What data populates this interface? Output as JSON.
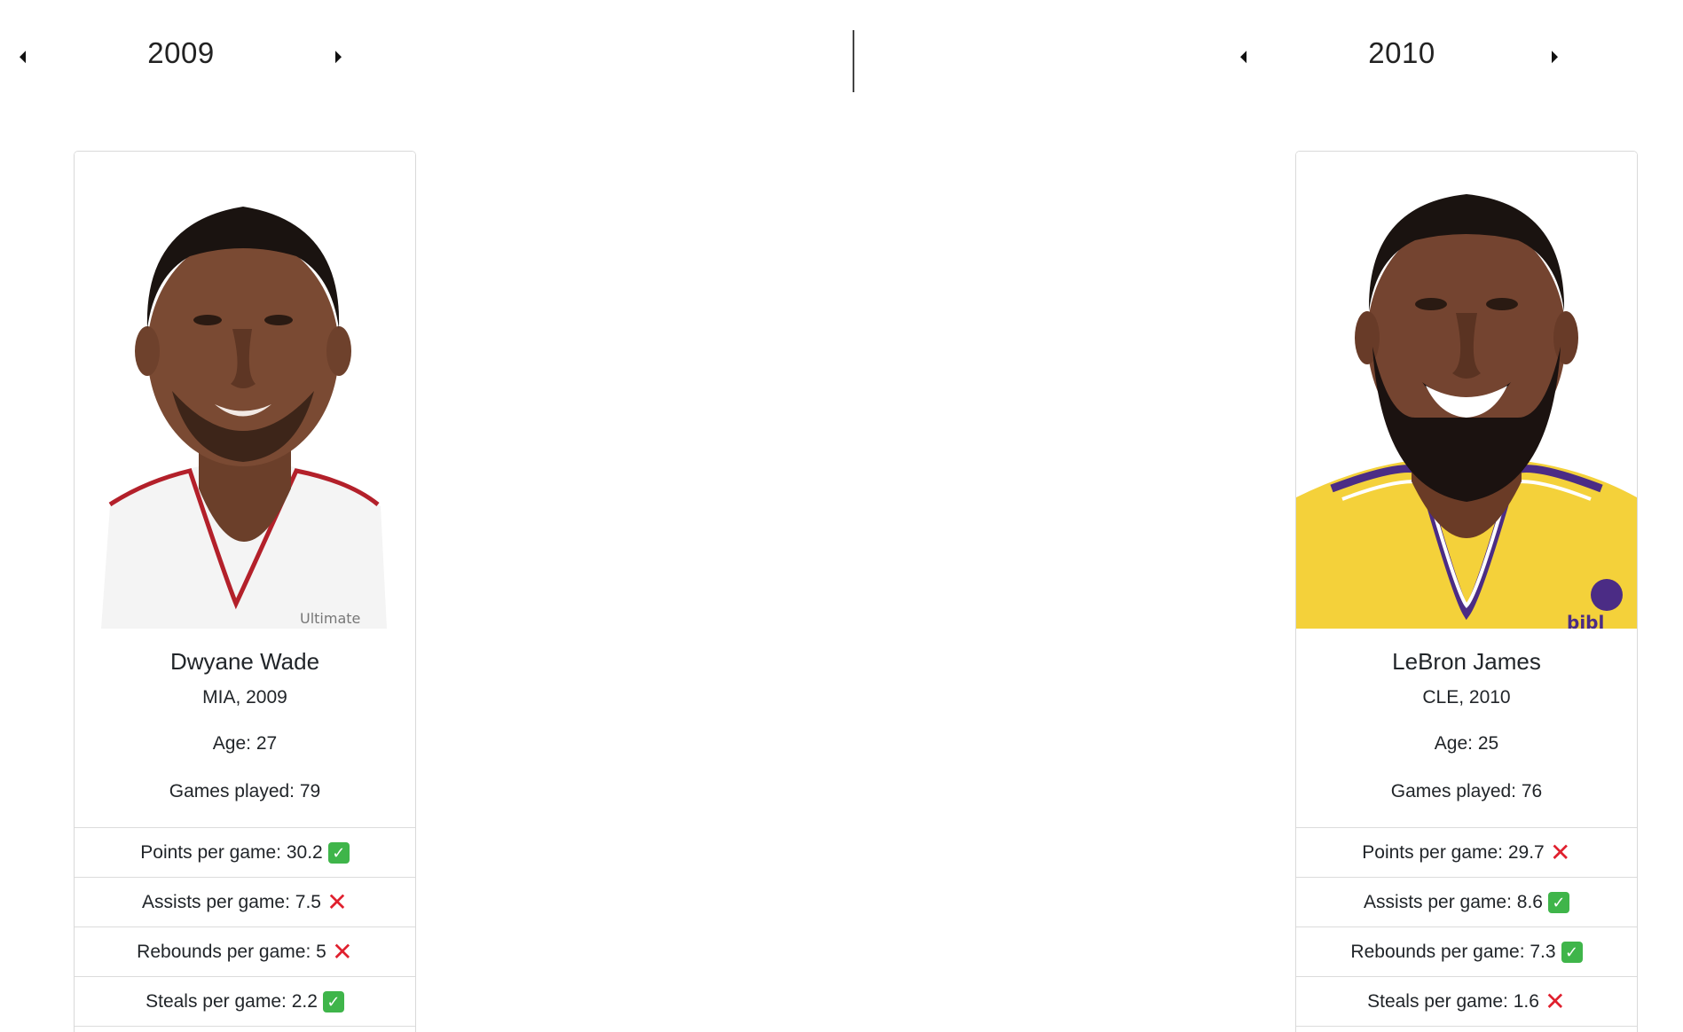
{
  "left": {
    "year": "2009",
    "player": {
      "name": "Dwyane Wade",
      "team_year": "MIA, 2009",
      "age": "Age: 27",
      "games": "Games played: 79",
      "stats": [
        {
          "label": "Points per game: 30.2",
          "result": "check"
        },
        {
          "label": "Assists per game: 7.5",
          "result": "cross"
        },
        {
          "label": "Rebounds per game: 5",
          "result": "cross"
        },
        {
          "label": "Steals per game: 2.2",
          "result": "check"
        }
      ],
      "photo_jersey_text": "Ultimate"
    }
  },
  "right": {
    "year": "2010",
    "player": {
      "name": "LeBron James",
      "team_year": "CLE, 2010",
      "age": "Age: 25",
      "games": "Games played: 76",
      "stats": [
        {
          "label": "Points per game: 29.7",
          "result": "cross"
        },
        {
          "label": "Assists per game: 8.6",
          "result": "check"
        },
        {
          "label": "Rebounds per game: 7.3",
          "result": "check"
        },
        {
          "label": "Steals per game: 1.6",
          "result": "cross"
        }
      ],
      "photo_jersey_text": "bibl"
    }
  },
  "icons": {
    "check": "check-mark-icon",
    "cross": "cross-mark-icon",
    "prev": "caret-left-icon",
    "next": "caret-right-icon"
  },
  "colors": {
    "check_bg": "#3fb54a",
    "cross": "#e0202e",
    "heat_red": "#b3202a",
    "lakers_gold": "#f4d13a",
    "lakers_purple": "#4b2c85"
  }
}
